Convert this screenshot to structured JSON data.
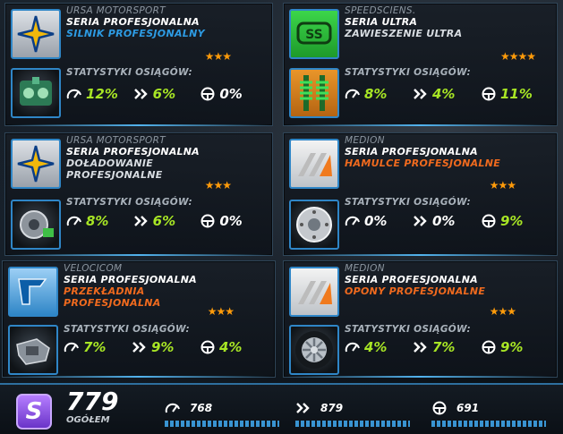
{
  "stat_heading": "STATYSTYKI OSIĄGÓW:",
  "cards": [
    {
      "brand": "URSA MOTORSPORT",
      "series": "SERIA PROFESJONALNA",
      "part_lines": [
        "SILNIK PROFESJONALNY"
      ],
      "part_color": "#2d9be3",
      "stars": "★★★",
      "stats": [
        "12%",
        "6%",
        "0%"
      ],
      "brand_icon": "star-emblem-icon",
      "part_icon": "engine-icon"
    },
    {
      "brand": "SPEEDSCIENS.",
      "series": "SERIA ULTRA",
      "part_lines": [
        "ZAWIESZENIE ULTRA"
      ],
      "part_color": "#d8dde2",
      "stars": "★★★★",
      "stats": [
        "8%",
        "4%",
        "11%"
      ],
      "brand_icon": "ss-logo-icon",
      "part_icon": "suspension-icon"
    },
    {
      "brand": "URSA MOTORSPORT",
      "series": "SERIA PROFESJONALNA",
      "part_lines": [
        "DOŁADOWANIE",
        "PROFESJONALNE"
      ],
      "part_color": "#d8dde2",
      "stars": "★★★",
      "stats": [
        "8%",
        "6%",
        "0%"
      ],
      "brand_icon": "star-emblem-icon",
      "part_icon": "turbo-icon"
    },
    {
      "brand": "MEDION",
      "series": "SERIA PROFESJONALNA",
      "part_lines": [
        "HAMULCE PROFESJONALNE"
      ],
      "part_color": "#f06a1e",
      "stars": "★★★",
      "stats": [
        "0%",
        "0%",
        "9%"
      ],
      "brand_icon": "medion-logo-icon",
      "part_icon": "brake-disc-icon"
    },
    {
      "brand": "VELOCICOM",
      "series": "SERIA PROFESJONALNA",
      "part_lines": [
        "PRZEKŁADNIA",
        "PROFESJONALNA"
      ],
      "part_color": "#f06a1e",
      "stars": "★★★",
      "stats": [
        "7%",
        "9%",
        "4%"
      ],
      "brand_icon": "velocicom-logo-icon",
      "part_icon": "gearbox-icon"
    },
    {
      "brand": "MEDION",
      "series": "SERIA PROFESJONALNA",
      "part_lines": [
        "OPONY PROFESJONALNE"
      ],
      "part_color": "#f06a1e",
      "stars": "★★★",
      "stats": [
        "4%",
        "7%",
        "9%"
      ],
      "brand_icon": "medion-logo-icon",
      "part_icon": "tire-icon"
    }
  ],
  "summary": {
    "badge": "S",
    "total": "779",
    "total_label": "OGÓŁEM",
    "top_speed": "768",
    "acceleration": "879",
    "handling": "691"
  },
  "colors": {
    "accent": "#2f86c7",
    "green": "#a8e625",
    "orange": "#f06a1e",
    "star": "#ff9b0a"
  }
}
